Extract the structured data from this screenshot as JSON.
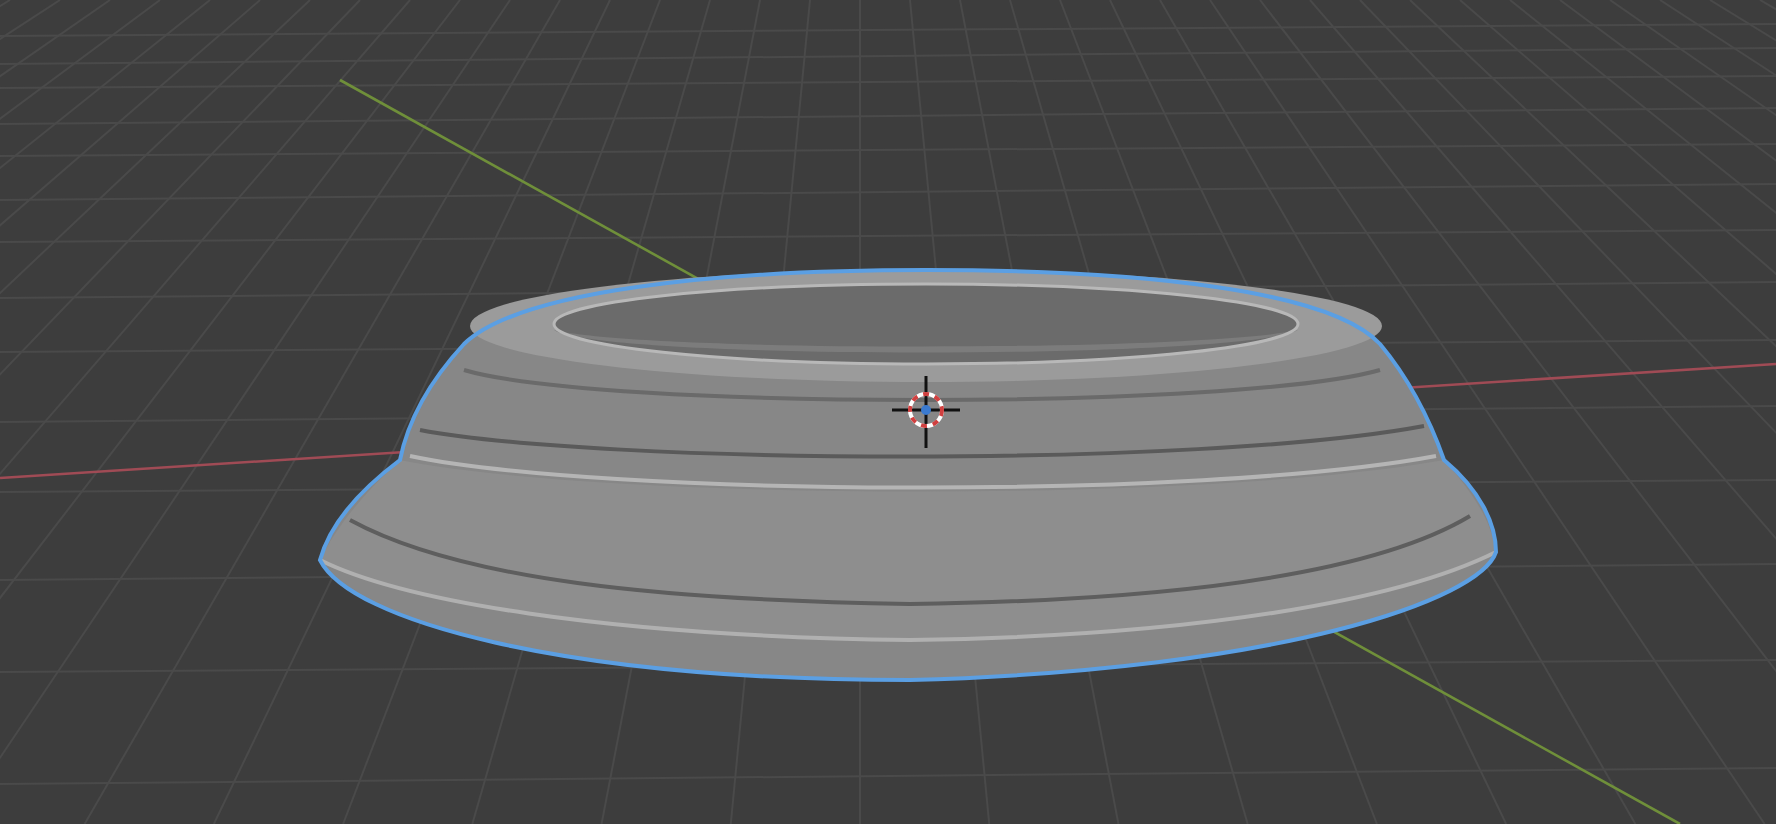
{
  "viewport": {
    "object_selected": true,
    "cursor_visible": true
  }
}
